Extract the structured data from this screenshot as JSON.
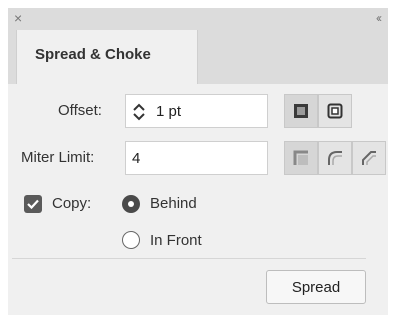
{
  "panel": {
    "title_close_glyph": "×",
    "title_collapse_glyph": "‹‹",
    "tab_label": "Spread & Choke"
  },
  "offset": {
    "label": "Offset:",
    "value": "1 pt",
    "corner_options": [
      "mitered-corner-icon",
      "rounded-corner-icon"
    ],
    "selected_corner": "mitered-corner-icon"
  },
  "miter": {
    "label": "Miter Limit:",
    "value": "4",
    "join_options": [
      "miter-join-icon",
      "round-join-icon",
      "bevel-join-icon"
    ],
    "selected_join": "miter-join-icon"
  },
  "copy": {
    "label": "Copy:",
    "checked": true,
    "options": [
      "Behind",
      "In Front"
    ],
    "selected": "Behind"
  },
  "action": {
    "button_label": "Spread"
  },
  "colors": {
    "panel_bg": "#f0f0f0",
    "title_bg": "#dcdcdc",
    "active_toggle": "#d6d6d6",
    "checkbox_fill": "#5a5a5a"
  }
}
